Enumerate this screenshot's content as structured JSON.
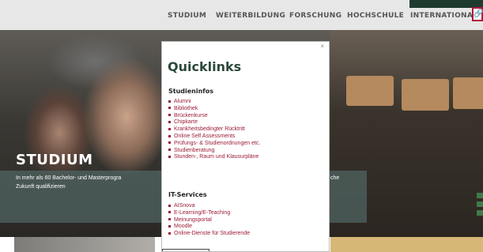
{
  "nav": {
    "items": [
      "STUDIUM",
      "WEITERBILDUNG",
      "FORSCHUNG",
      "HOCHSCHULE",
      "INTERNATIONAL"
    ],
    "quicklinks_icon": "link-icon"
  },
  "hero": {
    "title": "STUDIUM",
    "text_line1": "In mehr als 60 Bachelor- und Masterprogra",
    "text_line2": "Zukunft qualifizieren",
    "text_right": "che"
  },
  "modal": {
    "close_label": "×",
    "title": "Quicklinks",
    "sections": [
      {
        "heading": "Studieninfos",
        "links": [
          "Alumni",
          "Bibliothek",
          "Brückenkurse",
          "Chipkarte",
          "Krankheitsbedingter Rücktritt",
          "Online Self Assessments",
          "Prüfungs- & Studienordnungen etc.",
          "Studienberatung",
          "Stunden-, Raum und Klausurpläne"
        ]
      },
      {
        "heading": "IT-Services",
        "links": [
          "AISnova",
          "E-Learning/E-Teaching",
          "Meinungsportal",
          "Moodle",
          "Online-Dienste für Studierende"
        ]
      }
    ]
  },
  "colors": {
    "brand_green": "#2b4a3a",
    "link_red": "#9b1c36",
    "accent_red_border": "#b0173a",
    "nav_bg": "#e7e7e7"
  }
}
